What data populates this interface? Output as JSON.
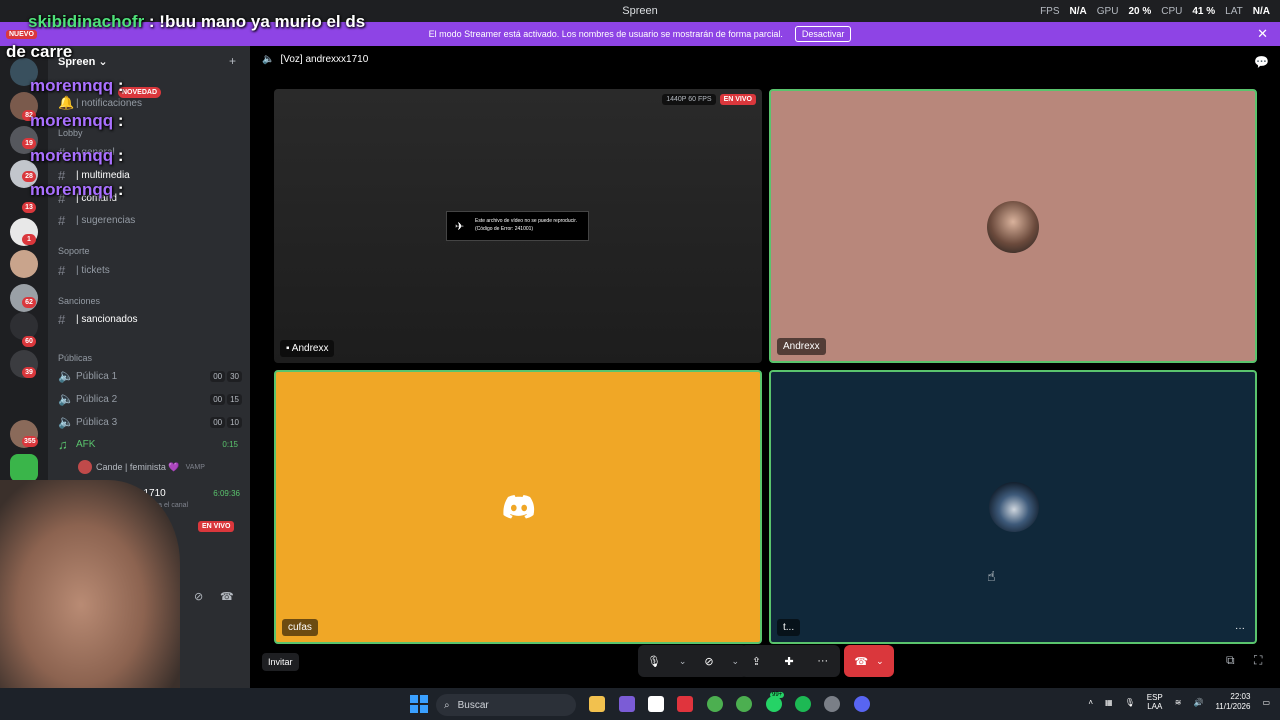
{
  "titlebar": {
    "app": "Spreen",
    "fps_label": "FPS",
    "fps": "N/A",
    "gpu_label": "GPU",
    "gpu": "20 %",
    "cpu_label": "CPU",
    "cpu": "41 %",
    "lat_label": "LAT",
    "lat": "N/A"
  },
  "banner": {
    "text": "El modo Streamer está activado. Los nombres de usuario se mostrarán de forma parcial.",
    "button": "Desactivar"
  },
  "server_name": "Spreen",
  "rail_badges": [
    "82",
    "19",
    "28",
    "13",
    "1",
    "62",
    "60",
    "39",
    "355"
  ],
  "rail_new_label": "NUEVO",
  "sidebar": {
    "notif": "| notificaciones",
    "lobby": "Lobby",
    "channels": [
      {
        "label": "| general"
      },
      {
        "label": "| multimedia"
      },
      {
        "label": "| comand"
      },
      {
        "label": "| sugerencias"
      }
    ],
    "soporte": "Soporte",
    "tickets": "| tickets",
    "sanciones": "Sanciones",
    "sancionados": "| sancionados",
    "publicas": "Públicas",
    "voice": [
      {
        "label": "Pública 1",
        "a": "00",
        "b": "30"
      },
      {
        "label": "Pública 2",
        "a": "00",
        "b": "15"
      },
      {
        "label": "Pública 3",
        "a": "00",
        "b": "10"
      }
    ],
    "afk": "AFK",
    "afk_time": "0:15",
    "afk_user": "Cande | feminista 💜",
    "afk_user_tag": "VAMP",
    "self_user": "drexxx1710",
    "self_time": "6:09:36",
    "self_status": "para el canal",
    "live_badge": "EN VIVO",
    "new_badge": "NOVEDAD"
  },
  "voice_header": "[Voz] andrexxx1710",
  "tiles": [
    {
      "name": "Andrexx",
      "quality": "1440P 60 FPS",
      "live": "EN VIVO",
      "error_line1": "Este archivo de vídeo no se puede reproducir.",
      "error_line2": "(Código de Error: 241001)"
    },
    {
      "name": "Andrexx"
    },
    {
      "name": "cufas"
    },
    {
      "name": "t..."
    }
  ],
  "invite": "Invitar",
  "taskbar": {
    "search": "Buscar",
    "lang1": "ESP",
    "lang2": "LAA",
    "time": "22:03",
    "date": "11/1/2026",
    "badge": "99+"
  },
  "chat": [
    {
      "user": "skibidinachofr",
      "text": " : !buu mano ya murio el ds",
      "color": "#4fe37a"
    },
    {
      "user": "",
      "text": "de carre",
      "color": "#ffffff"
    },
    {
      "user": "morennqq",
      "text": " :",
      "color": "#a970ff"
    },
    {
      "user": "morennqq",
      "text": " :",
      "color": "#a970ff"
    },
    {
      "user": "morennqq",
      "text": " :",
      "color": "#a970ff"
    },
    {
      "user": "morennqq",
      "text": " :",
      "color": "#a970ff"
    }
  ],
  "colors": {
    "accent": "#8e44e5",
    "danger": "#da373c",
    "speaking": "#5ac46d",
    "tile_orange": "#f0a726",
    "tile_navy": "#10283a",
    "tile_rose": "#b8877b"
  }
}
